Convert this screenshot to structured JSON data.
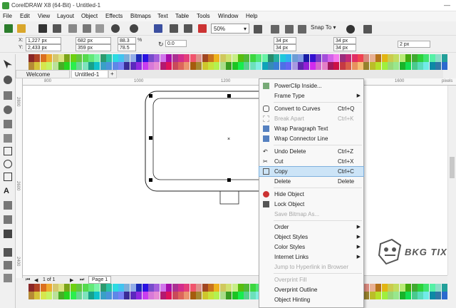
{
  "titlebar": {
    "title": "CorelDRAW X8 (64-Bit) - Untitled-1"
  },
  "menu": [
    "File",
    "Edit",
    "View",
    "Layout",
    "Object",
    "Effects",
    "Bitmaps",
    "Text",
    "Table",
    "Tools",
    "Window",
    "Help"
  ],
  "toolbar": {
    "zoom": "50%",
    "snap": "Snap To"
  },
  "props": {
    "x_label": "X:",
    "x": "1,227 px",
    "y_label": "Y:",
    "y": "2,433 px",
    "w": "682 px",
    "h": "359 px",
    "sx": "88.3",
    "sy": "78.5",
    "pct": "%",
    "angle": "0.0",
    "c1": "34 px",
    "c2": "34 px",
    "c3": "34 px",
    "c4": "34 px",
    "outline": "2 px"
  },
  "tabs": {
    "welcome": "Welcome Screen",
    "doc": "Untitled-1",
    "add": "+"
  },
  "ruler": {
    "marks": [
      "800",
      "1000",
      "1200",
      "1400",
      "1600",
      "1800",
      "2000"
    ],
    "unit": "pixels",
    "v1": "2800",
    "v2": "2600",
    "v3": "2400"
  },
  "pagebar": {
    "page_of": "1  of  1",
    "page_tab": "Page 1"
  },
  "context_menu": {
    "powerclip": "PowerClip Inside...",
    "frame_type": "Frame Type",
    "convert": "Convert to Curves",
    "convert_key": "Ctrl+Q",
    "break_apart": "Break Apart",
    "break_key": "Ctrl+K",
    "wrap_para": "Wrap Paragraph Text",
    "wrap_conn": "Wrap Connector Line",
    "undo": "Undo Delete",
    "undo_key": "Ctrl+Z",
    "cut": "Cut",
    "cut_key": "Ctrl+X",
    "copy": "Copy",
    "copy_key": "Ctrl+C",
    "delete": "Delete",
    "delete_key": "Delete",
    "hide": "Hide Object",
    "lock": "Lock Object",
    "save_bitmap": "Save Bitmap As...",
    "order": "Order",
    "obj_styles": "Object Styles",
    "color_styles": "Color Styles",
    "internet": "Internet Links",
    "jump": "Jump to Hyperlink in Browser",
    "overprint_fill": "Overprint Fill",
    "overprint_outline": "Overprint Outline",
    "obj_hinting": "Object Hinting"
  },
  "watermark": {
    "text": "BKG TIX"
  }
}
